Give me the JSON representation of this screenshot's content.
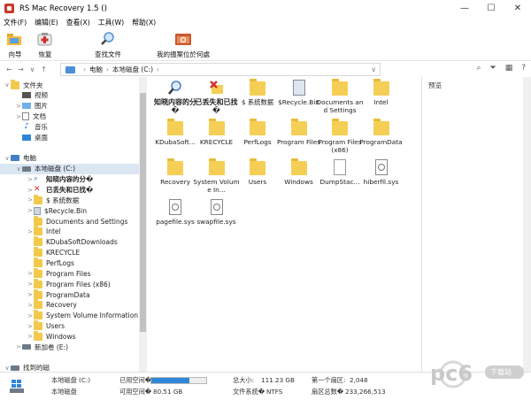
{
  "window": {
    "title": "RS Mac Recovery 1.5 ()",
    "minimize": "—",
    "maximize": "☐",
    "close": "✕"
  },
  "menu": [
    "文件(F)",
    "编辑(E)",
    "查看(X)",
    "工具(W)",
    "帮助(X)"
  ],
  "toolbar": [
    {
      "label": "向导",
      "icon": "wizard-icon"
    },
    {
      "label": "恢复",
      "icon": "recover-icon"
    },
    {
      "label": "查找文件",
      "icon": "search-icon"
    },
    {
      "label": "我的搵案位於何處",
      "icon": "folder-search-icon"
    }
  ],
  "address": {
    "path": [
      "电脑",
      "本地磁盘 (C:)"
    ],
    "search_icon": "search-icon"
  },
  "tree": {
    "items": [
      {
        "label": "文件夹",
        "level": 0,
        "caret": "∨",
        "icon": "folder"
      },
      {
        "label": "视频",
        "level": 1,
        "caret": "",
        "icon": "video"
      },
      {
        "label": "图片",
        "level": 1,
        "caret": ">",
        "icon": "picture"
      },
      {
        "label": "文档",
        "level": 1,
        "caret": ">",
        "icon": "doc"
      },
      {
        "label": "音乐",
        "level": 1,
        "caret": "",
        "icon": "music"
      },
      {
        "label": "桌面",
        "level": 1,
        "caret": "",
        "icon": "desktop"
      },
      {
        "label": "",
        "level": 0,
        "caret": "",
        "icon": "none"
      },
      {
        "label": "电脑",
        "level": 0,
        "caret": "∨",
        "icon": "pc"
      },
      {
        "label": "本地磁盘 (C:)",
        "level": 1,
        "caret": "∨",
        "icon": "drive",
        "selected": true
      },
      {
        "label": "知晓内容的分�",
        "level": 2,
        "caret": ">",
        "icon": "magnifier",
        "bold": true
      },
      {
        "label": "已丢失和已找�",
        "level": 2,
        "caret": ">",
        "icon": "lost",
        "bold": true
      },
      {
        "label": "$ 系统数据",
        "level": 2,
        "caret": ">",
        "icon": "folder"
      },
      {
        "label": "$Recycle.Bin",
        "level": 2,
        "caret": ">",
        "icon": "recycle"
      },
      {
        "label": "Documents and Settings",
        "level": 2,
        "caret": "",
        "icon": "folder"
      },
      {
        "label": "Intel",
        "level": 2,
        "caret": ">",
        "icon": "folder"
      },
      {
        "label": "KDubaSoftDownloads",
        "level": 2,
        "caret": "",
        "icon": "folder"
      },
      {
        "label": "KRECYCLE",
        "level": 2,
        "caret": "",
        "icon": "folder"
      },
      {
        "label": "PerfLogs",
        "level": 2,
        "caret": "",
        "icon": "folder"
      },
      {
        "label": "Program Files",
        "level": 2,
        "caret": ">",
        "icon": "folder"
      },
      {
        "label": "Program Files (x86)",
        "level": 2,
        "caret": ">",
        "icon": "folder"
      },
      {
        "label": "ProgramData",
        "level": 2,
        "caret": ">",
        "icon": "folder"
      },
      {
        "label": "Recovery",
        "level": 2,
        "caret": ">",
        "icon": "folder"
      },
      {
        "label": "System Volume Information",
        "level": 2,
        "caret": ">",
        "icon": "folder"
      },
      {
        "label": "Users",
        "level": 2,
        "caret": ">",
        "icon": "folder"
      },
      {
        "label": "Windows",
        "level": 2,
        "caret": ">",
        "icon": "folder"
      },
      {
        "label": "新加卷 (E:)",
        "level": 1,
        "caret": ">",
        "icon": "drive"
      },
      {
        "label": "",
        "level": 0,
        "caret": "",
        "icon": "none"
      },
      {
        "label": "找到的磁",
        "level": 0,
        "caret": "∨",
        "icon": "drive"
      }
    ]
  },
  "files": [
    {
      "name": "知晓内容的分�",
      "type": "magnifier",
      "bold": true
    },
    {
      "name": "已丢失和已找�",
      "type": "lost",
      "bold": true
    },
    {
      "name": "$ 系统数据",
      "type": "folder"
    },
    {
      "name": "$Recycle.Bin",
      "type": "recycle"
    },
    {
      "name": "Documents and Settings",
      "type": "folder"
    },
    {
      "name": "Intel",
      "type": "folder"
    },
    {
      "name": "KDubaSoft...",
      "type": "folder"
    },
    {
      "name": "KRECYCLE",
      "type": "folder"
    },
    {
      "name": "PerfLogs",
      "type": "folder"
    },
    {
      "name": "Program Files",
      "type": "folder"
    },
    {
      "name": "Program Files (x86)",
      "type": "folder"
    },
    {
      "name": "ProgramData",
      "type": "folder"
    },
    {
      "name": "Recovery",
      "type": "folder"
    },
    {
      "name": "System Volume In...",
      "type": "folder"
    },
    {
      "name": "Users",
      "type": "folder"
    },
    {
      "name": "Windows",
      "type": "folder"
    },
    {
      "name": "DumpStac...",
      "type": "doc"
    },
    {
      "name": "hiberfil.sys",
      "type": "sys"
    },
    {
      "name": "pagefile.sys",
      "type": "sys"
    },
    {
      "name": "swapfile.sys",
      "type": "sys"
    }
  ],
  "preview": {
    "title": "预览"
  },
  "status": {
    "drive_name": "本地磁盘 (C:)",
    "drive_type": "本地磁盘",
    "used_label": "已用空间�",
    "used_fraction": 0.7,
    "free_label": "可用空间�",
    "free_value": "80.51 GB",
    "total_label": "总大小:",
    "total_value": "111.23 GB",
    "fs_label": "文件系统�",
    "fs_value": "NTFS",
    "first_sector_label": "第一个扇区:",
    "first_sector_value": "2,048",
    "sector_count_label": "扇区总数�",
    "sector_count_value": "233,266,513"
  },
  "watermark": {
    "text": "pc6",
    "badge": "下载站"
  }
}
